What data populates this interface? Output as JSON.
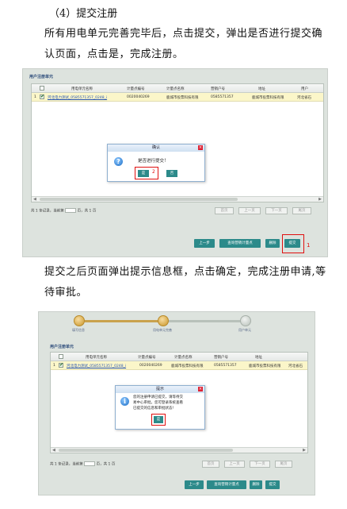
{
  "doc": {
    "heading": "（4）提交注册",
    "para1": "所有用电单元完善完毕后，点击提交，弹出是否进行提交确认页面，点击是，完成注册。",
    "para2": "提交之后页面弹出提示信息框，点击确定，完成注册申请,等待审批。"
  },
  "shot1": {
    "panel_title": "用户注册单元",
    "columns": [
      "用电单元名称",
      "计量点编号",
      "计量点名称",
      "营销户号",
      "地址",
      "用户"
    ],
    "row": {
      "index": "1",
      "name": "河北电力测试_0585571357_0248_i",
      "meter_id": "0020040269",
      "meter_name": "鹿城市投票科技有限",
      "account": "0585571357",
      "address": "鹿城市投票科技有限",
      "user": "河北省石"
    },
    "pager": {
      "total": "共 1 条记录，当前第",
      "page_of": "页，共 1 页",
      "first": "首页",
      "prev": "上一页",
      "next": "下一页",
      "last": "尾页"
    },
    "buttons": {
      "prev_step": "上一步",
      "query_meter": "查询营销计量点",
      "delete": "删除",
      "submit": "提交"
    },
    "dialog": {
      "title": "确认",
      "message": "是否进行提交！",
      "yes": "是",
      "no": "否"
    },
    "annotations": {
      "yes_num": "2",
      "submit_num": "1"
    }
  },
  "shot2": {
    "steps": [
      "填写信息",
      "用电单元完善",
      "用户单元"
    ],
    "panel_title": "用户注册单元",
    "columns": [
      "用电单元名称",
      "计量点编号",
      "计量点名称",
      "营销户号",
      "地址"
    ],
    "row": {
      "index": "1",
      "name": "河北电力测试_0585571357_0248_i",
      "meter_id": "0020040269",
      "meter_name": "鹿城市投票科技有限",
      "account": "0585571357",
      "address": "鹿城市投票科技有限",
      "user": "河北省石"
    },
    "pager": {
      "total": "共 1 条记录，当前第",
      "page_of": "页，共 1 页",
      "first": "首页",
      "prev": "上一页",
      "next": "下一页",
      "last": "尾页"
    },
    "buttons": {
      "prev_step": "上一步",
      "query_meter": "查询营销计量点",
      "delete": "删除",
      "submit": "提交"
    },
    "dialog": {
      "title": "提示",
      "line1": "您的注册申请已提交，请等待交",
      "line2": "易中心审批，您可登录系统查看",
      "line3": "已提交的信息和审批状态!",
      "ok": "是"
    }
  },
  "colors": {
    "accent": "#2c8a8a",
    "highlight_row": "#fbf6c9",
    "annotation_red": "#e01010",
    "panel_bg": "#dde3de"
  }
}
